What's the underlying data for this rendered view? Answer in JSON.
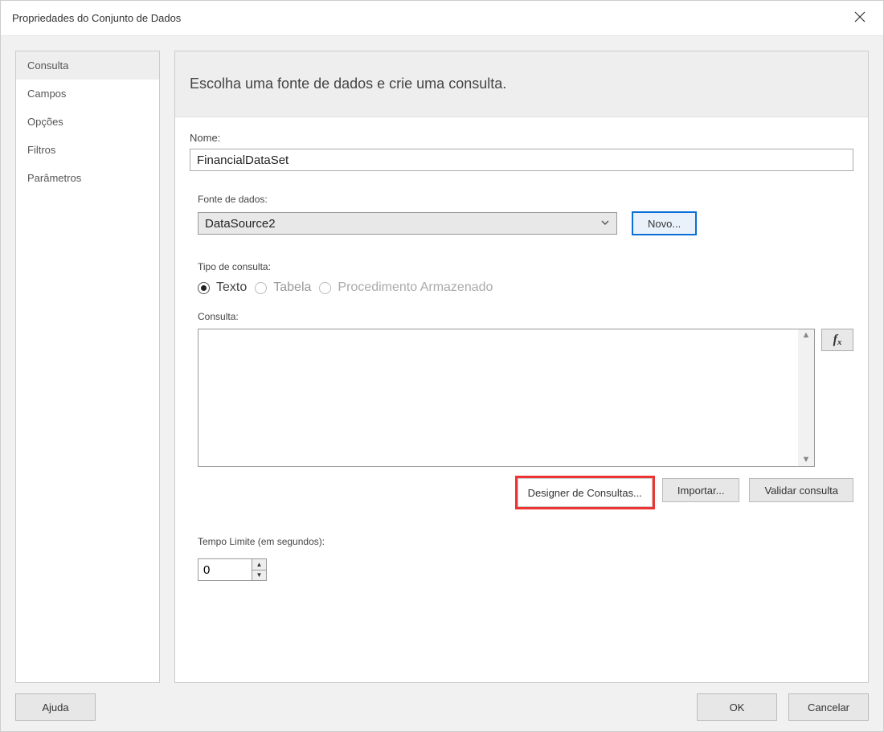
{
  "window": {
    "title": "Propriedades do Conjunto de Dados"
  },
  "sidebar": {
    "items": [
      {
        "label": "Consulta",
        "active": true
      },
      {
        "label": "Campos",
        "active": false
      },
      {
        "label": "Opções",
        "active": false
      },
      {
        "label": "Filtros",
        "active": false
      },
      {
        "label": "Parâmetros",
        "active": false
      }
    ]
  },
  "main": {
    "heading": "Escolha uma fonte de dados e crie uma consulta.",
    "name_label": "Nome:",
    "name_value": "FinancialDataSet",
    "datasource_label": "Fonte de dados:",
    "datasource_value": "DataSource2",
    "new_button": "Novo...",
    "querytype_label": "Tipo de consulta:",
    "radios": {
      "text": "Texto",
      "table": "Tabela",
      "sp": "Procedimento Armazenado"
    },
    "query_label": "Consulta:",
    "fx_label": "fx",
    "designer_button": "Designer de Consultas...",
    "import_button": "Importar...",
    "validate_button": "Validar consulta",
    "timeout_label": "Tempo Limite (em segundos):",
    "timeout_value": "0"
  },
  "footer": {
    "help": "Ajuda",
    "ok": "OK",
    "cancel": "Cancelar"
  }
}
